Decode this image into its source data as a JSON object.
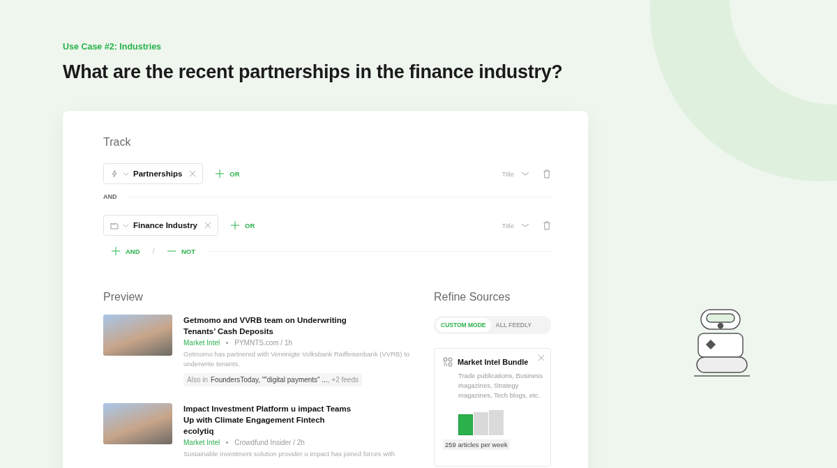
{
  "eyebrow": "Use Case #2: Industries",
  "headline": "What are the recent partnerships in the finance industry?",
  "track": {
    "title": "Track",
    "rules": [
      {
        "term": "Partnerships",
        "or_label": "OR",
        "scope": "Title"
      },
      {
        "term": "Finance Industry",
        "or_label": "OR",
        "scope": "Title"
      }
    ],
    "joiner": "AND",
    "add_and": "AND",
    "separator": "/",
    "add_not": "NOT"
  },
  "preview": {
    "title": "Preview",
    "articles": [
      {
        "title": "Getmomo and VVRB team on Underwriting Tenants’ Cash Deposits",
        "feed": "Market Intel",
        "source": "PYMNTS.com / 1h",
        "summary": "Getmomo has partnered with Vereinigte Volksbank Raiffeisenbank (VVRB) to underwrite tenants.",
        "also": {
          "prefix": "Also in",
          "feeds": "FoundersToday, \"\"digital payments\" ...",
          "more": ", +2 feeds"
        }
      },
      {
        "title": "Impact Investment Platform u impact Teams Up with Climate Engagement Fintech ecolytiq",
        "feed": "Market Intel",
        "source": "Crowdfund Insider / 2h",
        "summary": "Sustainable investment solution provider u impact has joined forces with"
      }
    ]
  },
  "refine": {
    "title": "Refine Sources",
    "modes": [
      {
        "label": "CUSTOM MODE",
        "selected": true
      },
      {
        "label": "ALL FEEDLY",
        "selected": false
      }
    ],
    "bundle": {
      "name": "Market Intel Bundle",
      "description": "Trade publications, Business magazines, Strategy magazines, Tech blogs, etc.",
      "volumes": [
        {
          "selected": true
        },
        {
          "selected": false
        },
        {
          "selected": false
        }
      ],
      "reading": "259 articles per week"
    }
  }
}
